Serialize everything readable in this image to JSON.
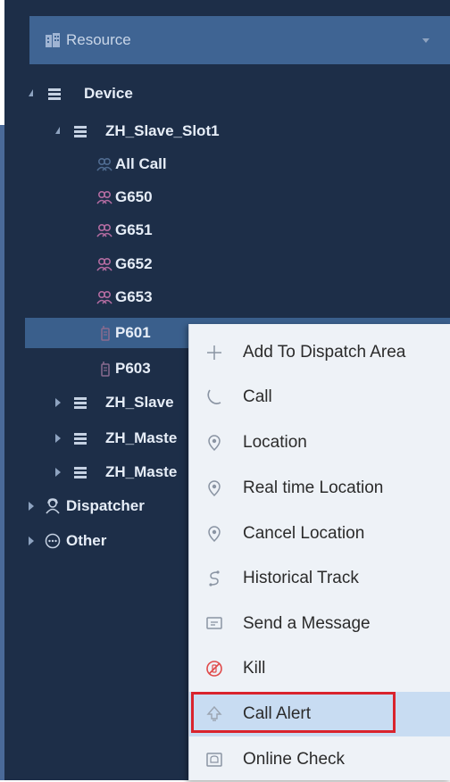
{
  "resource": {
    "label": "Resource",
    "icon": "building-icon",
    "caret": "chevron-down-icon"
  },
  "tree": {
    "device": {
      "label": "Device",
      "icon": "device-icon"
    },
    "zh_slave_slot1": {
      "label": "ZH_Slave_Slot1",
      "icon": "device-icon"
    },
    "all_call": {
      "label": "All Call",
      "icon": "group-icon"
    },
    "g650": {
      "label": "G650",
      "icon": "group-icon"
    },
    "g651": {
      "label": "G651",
      "icon": "group-icon"
    },
    "g652": {
      "label": "G652",
      "icon": "group-icon"
    },
    "g653": {
      "label": "G653",
      "icon": "group-icon"
    },
    "p601": {
      "label": "P601",
      "icon": "radio-icon"
    },
    "p603": {
      "label": "P603",
      "icon": "radio-icon"
    },
    "zh_slave_2": {
      "label": "ZH_Slave",
      "icon": "device-icon"
    },
    "zh_master_1": {
      "label": "ZH_Maste",
      "icon": "device-icon"
    },
    "zh_master_2": {
      "label": "ZH_Maste",
      "icon": "device-icon"
    },
    "dispatcher": {
      "label": "Dispatcher",
      "icon": "dispatcher-icon"
    },
    "other": {
      "label": "Other",
      "icon": "ellipsis-circle-icon"
    }
  },
  "menu": {
    "items": [
      {
        "label": "Add To Dispatch Area",
        "icon": "plus-icon"
      },
      {
        "label": "Call",
        "icon": "phone-icon"
      },
      {
        "label": "Location",
        "icon": "location-pin-icon"
      },
      {
        "label": "Real time Location",
        "icon": "location-pin-icon"
      },
      {
        "label": "Cancel Location",
        "icon": "location-pin-icon"
      },
      {
        "label": "Historical Track",
        "icon": "track-icon"
      },
      {
        "label": "Send a Message",
        "icon": "message-icon"
      },
      {
        "label": "Kill",
        "icon": "kill-icon"
      },
      {
        "label": "Call Alert",
        "icon": "call-alert-icon"
      },
      {
        "label": "Online Check",
        "icon": "online-check-icon"
      }
    ]
  },
  "colors": {
    "panel_bg": "#1d2e48",
    "resource_bar": "#3f6493",
    "selected_row": "#3a5f8c",
    "menu_bg": "#eef2f7",
    "menu_highlight": "#c8dcf2",
    "alert_outline": "#d9232d"
  }
}
